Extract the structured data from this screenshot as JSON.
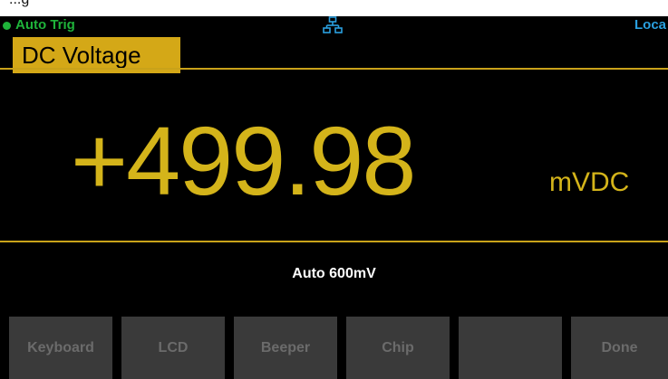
{
  "caption": "...g",
  "status": {
    "trigger": "Auto Trig",
    "remote": "Loca",
    "network_icon": "network-icon",
    "trigger_color": "#1fb33a",
    "remote_color": "#2aa0e0",
    "network_color": "#2aa0e0"
  },
  "function": {
    "title": "DC Voltage"
  },
  "measurement": {
    "value": "+499.98",
    "unit": "mVDC",
    "range": "Auto  600mV"
  },
  "softkeys": [
    {
      "label": "Keyboard"
    },
    {
      "label": "LCD"
    },
    {
      "label": "Beeper"
    },
    {
      "label": "Chip"
    },
    {
      "label": ""
    },
    {
      "label": "Done"
    }
  ]
}
